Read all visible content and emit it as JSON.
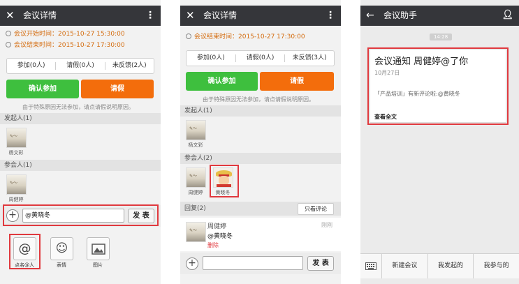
{
  "screen1": {
    "title": "会议详情",
    "start_time": "会议开始时间：2015-10-27 15:30:00",
    "end_time": "会议结束时间：2015-10-27 17:30:00",
    "tabs": [
      "参加(0人)",
      "请假(0人)",
      "未反馈(2人)"
    ],
    "confirm_label": "确认参加",
    "leave_label": "请假",
    "note": "由于特殊原因无法参加，请点请假说明原因。",
    "initiator_header": "发起人(1)",
    "initiator_name": "杨文彩",
    "participants_header": "参会人(1)",
    "participant_name": "周健婷",
    "input_value": "@黄晓冬",
    "send_label": "发 表",
    "tools": [
      {
        "icon": "at-icon",
        "label": "点名@人"
      },
      {
        "icon": "emoji-icon",
        "label": "表情"
      },
      {
        "icon": "image-icon",
        "label": "图片"
      }
    ]
  },
  "screen2": {
    "title": "会议详情",
    "end_time": "会议结束时间：2015-10-27 17:30:00",
    "tabs": [
      "参加(0人)",
      "请假(0人)",
      "未反馈(3人)"
    ],
    "confirm_label": "确认参加",
    "leave_label": "请假",
    "note": "由于特殊原因无法参加，请点请假说明原因。",
    "initiator_header": "发起人(1)",
    "initiator_name": "杨文彩",
    "participants_header": "参会人(2)",
    "participants": [
      "周健婷",
      "黄晓冬"
    ],
    "replies_header": "回复(2)",
    "only_comments_label": "只看评论",
    "comment": {
      "author": "周健婷",
      "time": "刚刚",
      "text": "@黄晓冬",
      "delete_label": "删除"
    },
    "send_label": "发 表"
  },
  "screen3": {
    "title": "会议助手",
    "timestamp": "14:28",
    "card_title": "会议通知 周健婷@了你",
    "card_date": "10月27日",
    "card_body": "「产品培训」有新评论啦:@黄晓冬",
    "card_link": "查看全文",
    "nav": [
      "新建会议",
      "我发起的",
      "我参与的"
    ]
  },
  "colors": {
    "titlebar": "#35363a",
    "green": "#3ebf3e",
    "orange": "#f36d0c",
    "time_text": "#d46b0d",
    "highlight_red": "#e0393e",
    "delete_red": "#e0393e"
  }
}
